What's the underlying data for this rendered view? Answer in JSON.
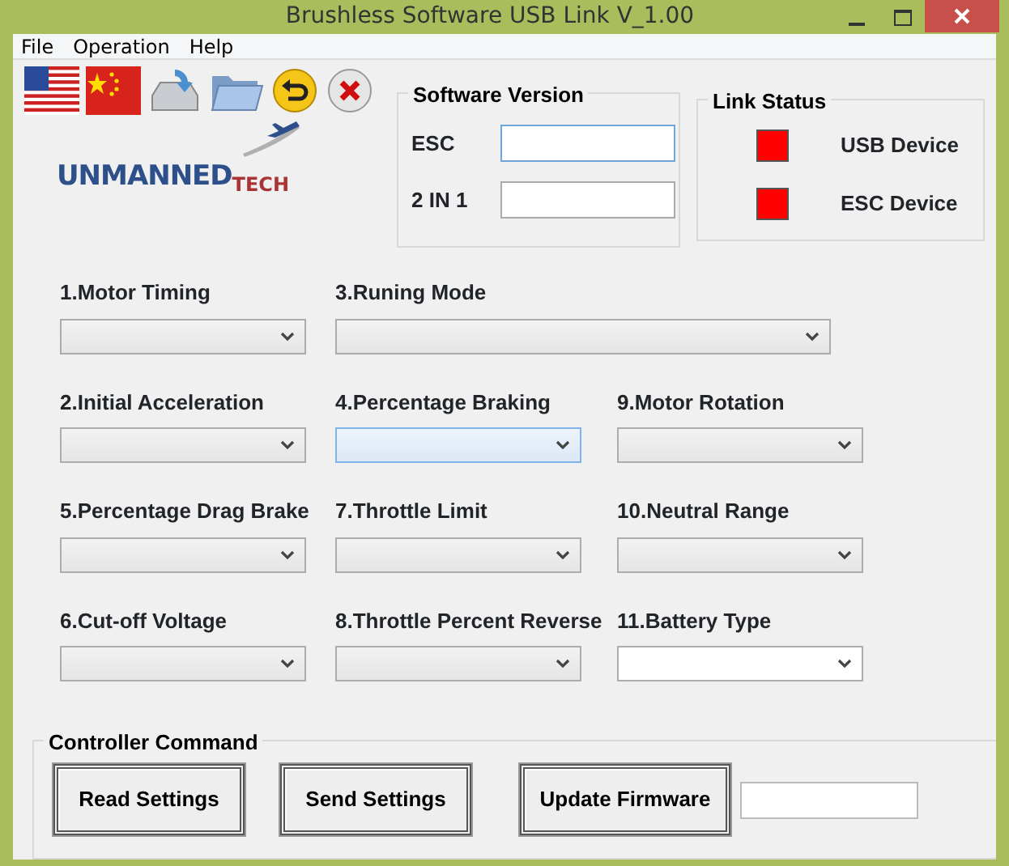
{
  "window": {
    "title": "Brushless Software USB Link V_1.00"
  },
  "menu": [
    "File",
    "Operation",
    "Help"
  ],
  "logo": {
    "main": "UNMANNED",
    "accent": "TECH"
  },
  "software_version": {
    "title": "Software Version",
    "fields": [
      {
        "label": "ESC",
        "focused": true
      },
      {
        "label": "2 IN 1",
        "focused": false
      }
    ]
  },
  "link_status": {
    "title": "Link Status",
    "devices": [
      {
        "label": "USB Device",
        "connected": false
      },
      {
        "label": "ESC Device",
        "connected": false
      }
    ]
  },
  "setting_rows": [
    [
      {
        "label": "1.Motor Timing",
        "kind": "normal",
        "hovered": false,
        "focused": false
      },
      {
        "label": "3.Runing Mode",
        "kind": "wide",
        "hovered": false,
        "focused": false
      }
    ],
    [
      {
        "label": "2.Initial Acceleration",
        "kind": "normal",
        "hovered": false,
        "focused": false
      },
      {
        "label": "4.Percentage Braking",
        "kind": "normal",
        "hovered": true,
        "focused": false
      },
      {
        "label": "9.Motor Rotation",
        "kind": "normal",
        "hovered": false,
        "focused": false
      }
    ],
    [
      {
        "label": "5.Percentage Drag Brake",
        "kind": "normal",
        "hovered": false,
        "focused": false
      },
      {
        "label": "7.Throttle Limit",
        "kind": "normal",
        "hovered": false,
        "focused": false
      },
      {
        "label": "10.Neutral Range",
        "kind": "normal",
        "hovered": false,
        "focused": false
      }
    ],
    [
      {
        "label": "6.Cut-off Voltage",
        "kind": "normal",
        "hovered": false,
        "focused": false
      },
      {
        "label": "8.Throttle Percent Reverse",
        "kind": "normal",
        "hovered": false,
        "focused": false
      },
      {
        "label": "11.Battery Type",
        "kind": "normal",
        "hovered": false,
        "focused": true
      }
    ]
  ],
  "controller_command": {
    "title": "Controller Command",
    "buttons": [
      "Read Settings",
      "Send Settings",
      "Update Firmware"
    ]
  }
}
